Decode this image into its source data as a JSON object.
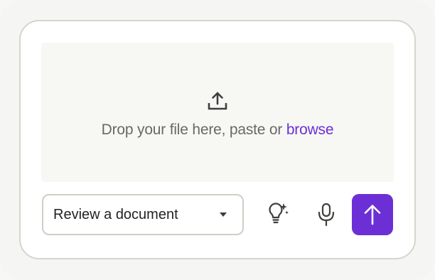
{
  "dropzone": {
    "text": "Drop your file here, paste or",
    "link": "browse",
    "icon": "upload-icon"
  },
  "task_select": {
    "selected": "Review a document",
    "icon": "chevron-down-icon"
  },
  "actions": {
    "suggest_icon": "lightbulb-sparkle-icon",
    "voice_icon": "microphone-icon",
    "send_icon": "arrow-up-icon"
  },
  "colors": {
    "accent": "#6c2fd6",
    "border": "#d6d5cc",
    "dropzone_bg": "#f7f7f4",
    "muted_text": "#6a6965"
  }
}
